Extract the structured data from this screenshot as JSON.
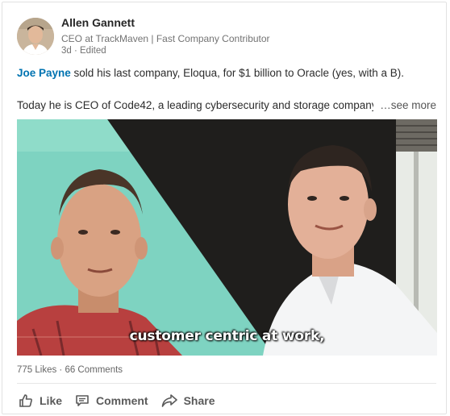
{
  "author": {
    "name": "Allen Gannett",
    "headline": "CEO at TrackMaven | Fast Company Contributor",
    "meta": "3d · Edited"
  },
  "post": {
    "mention": "Joe Payne",
    "line1_rest": " sold his last company, Eloqua, for $1 billion to Oracle (yes, with a B).",
    "line2": "Today he is CEO of Code42, a leading cybersecurity and storage company",
    "see_more": "…see more"
  },
  "video": {
    "caption": "customer centric at work,"
  },
  "stats": {
    "text": "775 Likes · 66 Comments"
  },
  "actions": {
    "like": "Like",
    "comment": "Comment",
    "share": "Share"
  },
  "icons": {
    "like": "thumbs-up-icon",
    "comment": "comment-icon",
    "share": "share-arrow-icon"
  },
  "colors": {
    "mention": "#0073b1",
    "caption_text": "#ffffff"
  }
}
